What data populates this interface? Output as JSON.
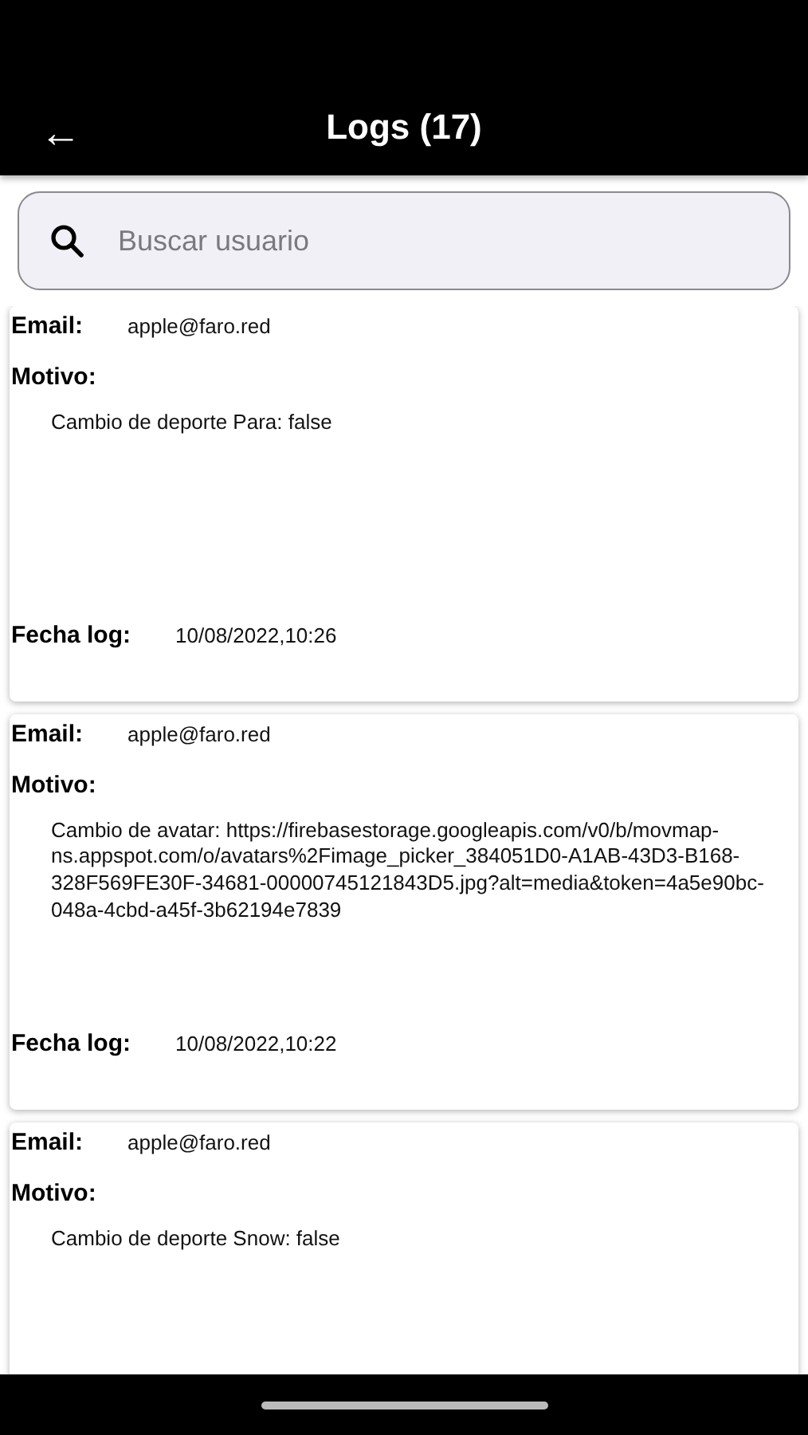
{
  "app_bar": {
    "back": "←",
    "title": "Logs (17)"
  },
  "search": {
    "placeholder": "Buscar usuario"
  },
  "logs": [
    {
      "email_label": "Email:",
      "email": "apple@faro.red",
      "motivo_label": "Motivo:",
      "motivo": "Cambio de deporte Para: false",
      "fecha_label": "Fecha log:",
      "fecha": "10/08/2022,10:26"
    },
    {
      "email_label": "Email:",
      "email": "apple@faro.red",
      "motivo_label": "Motivo:",
      "motivo": "Cambio de avatar: https://firebasestorage.googleapis.com/v0/b/movmap-ns.appspot.com/o/avatars%2Fimage_picker_384051D0-A1AB-43D3-B168-328F569FE30F-34681-00000745121843D5.jpg?alt=media&token=4a5e90bc-048a-4cbd-a45f-3b62194e7839",
      "fecha_label": "Fecha log:",
      "fecha": "10/08/2022,10:22"
    },
    {
      "email_label": "Email:",
      "email": "apple@faro.red",
      "motivo_label": "Motivo:",
      "motivo": "Cambio de deporte Snow: false"
    }
  ]
}
